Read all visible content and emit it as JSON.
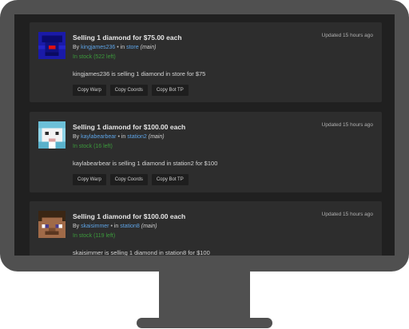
{
  "listings": [
    {
      "title": "Selling 1 diamond for $75.00 each",
      "updated": "Updated 15 hours ago",
      "by_prefix": "By",
      "seller": "kingjames236",
      "in_text": "in",
      "location": "store",
      "location_tag": "(main)",
      "stock": "In stock (522 left)",
      "description": "kingjames236 is selling 1 diamond in store for $75",
      "buttons": [
        "Copy Warp",
        "Copy Coords",
        "Copy Bot TP"
      ]
    },
    {
      "title": "Selling 1 diamond for $100.00 each",
      "updated": "Updated 15 hours ago",
      "by_prefix": "By",
      "seller": "kaylabearbear",
      "in_text": "in",
      "location": "station2",
      "location_tag": "(main)",
      "stock": "In stock (16 left)",
      "description": "kaylabearbear is selling 1 diamond in station2 for $100",
      "buttons": [
        "Copy Warp",
        "Copy Coords",
        "Copy Bot TP"
      ]
    },
    {
      "title": "Selling 1 diamond for $100.00 each",
      "updated": "Updated 15 hours ago",
      "by_prefix": "By",
      "seller": "skaisimmer",
      "in_text": "in",
      "location": "station8",
      "location_tag": "(main)",
      "stock": "In stock (119 left)",
      "description": "skaisimmer is selling 1 diamond in station8 for $100"
    }
  ]
}
